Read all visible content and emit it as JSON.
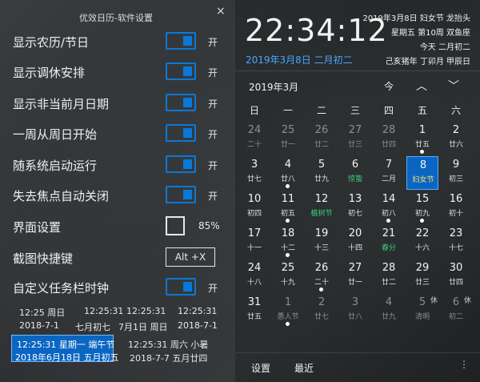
{
  "settings": {
    "title": "优效日历-软件设置",
    "close_icon": "×",
    "on_label": "开",
    "rows": [
      {
        "label": "显示农历/节日"
      },
      {
        "label": "显示调休安排"
      },
      {
        "label": "显示非当前月日期"
      },
      {
        "label": "一周从周日开始"
      },
      {
        "label": "随系统启动运行"
      },
      {
        "label": "失去焦点自动关闭"
      }
    ],
    "appearance_label": "界面设置",
    "appearance_percent": "85%",
    "hotkey_label": "截图快捷键",
    "hotkey_value": "Alt +X",
    "taskbar_label": "自定义任务栏时钟",
    "formats": [
      "12:25 周日",
      "12:25:31",
      "12:25:31",
      "2018-7-1",
      "七月初七",
      "7月1日 周日",
      "2018-7-1"
    ],
    "format_selected_line1": "12:25:31 星期一 端午节",
    "format_selected_line2": "2018年6月18日 五月初五",
    "format_last": "12:25:31 周六 小暑",
    "format_last2": "2018-7-7 五月廿四"
  },
  "calendar": {
    "time": "22:34:12",
    "today_line": "2019年3月8日  二月初二",
    "info_lines": [
      "2019年3月8日 妇女节 龙抬头",
      "星期五 第10周 双鱼座",
      "今天 二月初二",
      "己亥猪年 丁卯月 甲辰日"
    ],
    "month_title": "2019年3月",
    "nav_today": "今",
    "nav_up_icon": "︿",
    "nav_down_icon": "﹀",
    "weekdays": [
      "日",
      "一",
      "二",
      "三",
      "四",
      "五",
      "六"
    ],
    "days": [
      {
        "d": "24",
        "s": "二十",
        "other": true
      },
      {
        "d": "25",
        "s": "廿一",
        "other": true
      },
      {
        "d": "26",
        "s": "廿二",
        "other": true
      },
      {
        "d": "27",
        "s": "廿三",
        "other": true
      },
      {
        "d": "28",
        "s": "廿四",
        "other": true
      },
      {
        "d": "1",
        "s": "廿五",
        "dot": true
      },
      {
        "d": "2",
        "s": "廿六"
      },
      {
        "d": "3",
        "s": "廿七"
      },
      {
        "d": "4",
        "s": "廿八",
        "dot": true
      },
      {
        "d": "5",
        "s": "廿九"
      },
      {
        "d": "6",
        "s": "惊蛰",
        "green": true
      },
      {
        "d": "7",
        "s": "二月"
      },
      {
        "d": "8",
        "s": "妇女节",
        "today": true
      },
      {
        "d": "9",
        "s": "初三"
      },
      {
        "d": "10",
        "s": "初四"
      },
      {
        "d": "11",
        "s": "初五",
        "dot": true
      },
      {
        "d": "12",
        "s": "植树节",
        "green": true
      },
      {
        "d": "13",
        "s": "初七"
      },
      {
        "d": "14",
        "s": "初八",
        "dot": true
      },
      {
        "d": "15",
        "s": "初九",
        "dot": true
      },
      {
        "d": "16",
        "s": "初十"
      },
      {
        "d": "17",
        "s": "十一"
      },
      {
        "d": "18",
        "s": "十二",
        "dot": true
      },
      {
        "d": "19",
        "s": "十三"
      },
      {
        "d": "20",
        "s": "十四"
      },
      {
        "d": "21",
        "s": "春分",
        "green": true
      },
      {
        "d": "22",
        "s": "十六"
      },
      {
        "d": "23",
        "s": "十七"
      },
      {
        "d": "24",
        "s": "十八"
      },
      {
        "d": "25",
        "s": "十九"
      },
      {
        "d": "26",
        "s": "二十",
        "dot": true
      },
      {
        "d": "27",
        "s": "廿一"
      },
      {
        "d": "28",
        "s": "廿二"
      },
      {
        "d": "29",
        "s": "廿三"
      },
      {
        "d": "30",
        "s": "廿四"
      },
      {
        "d": "31",
        "s": "廿五"
      },
      {
        "d": "1",
        "s": "愚人节",
        "other": true,
        "dot": true
      },
      {
        "d": "2",
        "s": "廿七",
        "other": true
      },
      {
        "d": "3",
        "s": "廿八",
        "other": true
      },
      {
        "d": "4",
        "s": "廿九",
        "other": true
      },
      {
        "d": "5",
        "s": "清明",
        "other": true,
        "badge": "休"
      },
      {
        "d": "6",
        "s": "初二",
        "other": true,
        "badge": "休"
      }
    ],
    "footer_settings": "设置",
    "footer_recent": "最近",
    "footer_more_icon": "⋮"
  },
  "colors": {
    "accent": "#0a78d7",
    "selected_bg": "#0a66c2",
    "festival_green": "#39d07a",
    "today_text": "#4aa6ff"
  }
}
